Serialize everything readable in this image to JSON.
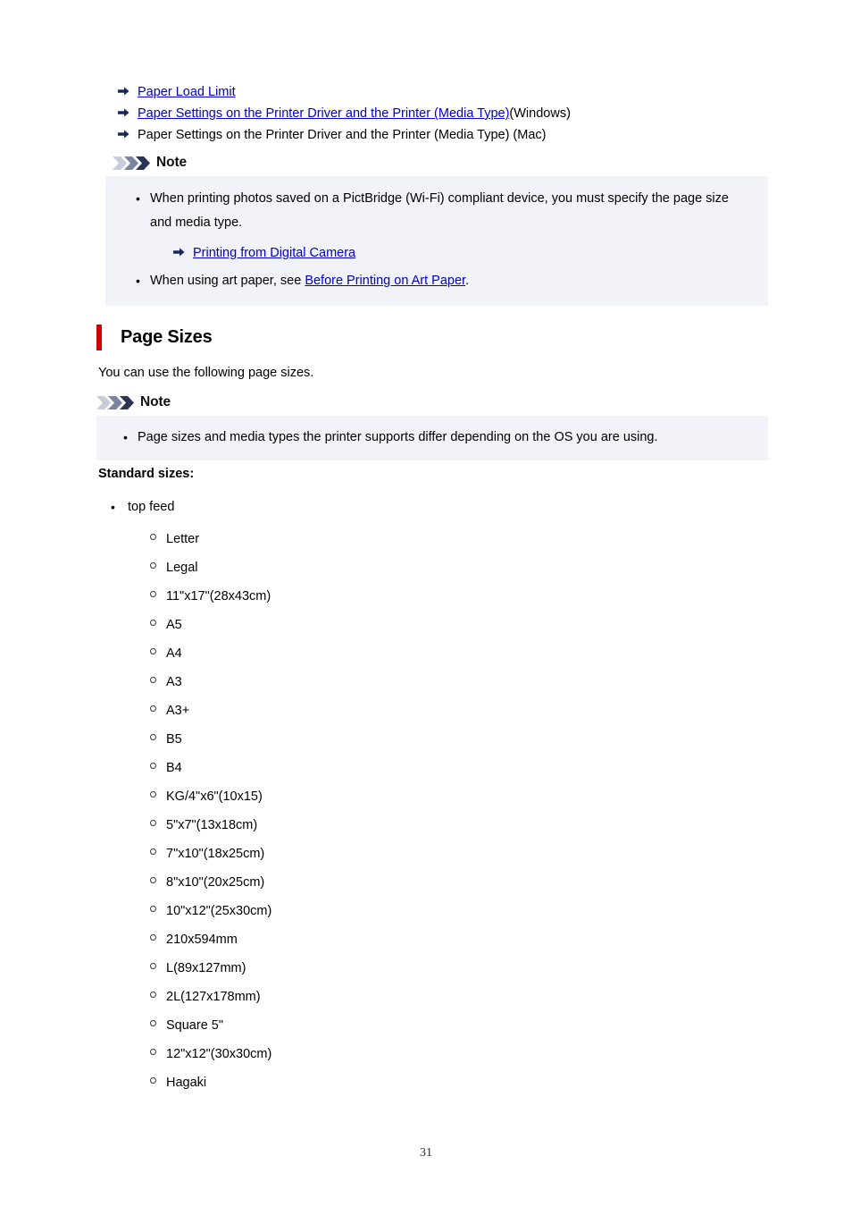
{
  "document": {
    "page_number": "31"
  },
  "top_links": [
    {
      "icon": "arrow-right-icon",
      "link_text": "Paper Load Limit",
      "is_link": true,
      "suffix": ""
    },
    {
      "icon": "arrow-right-icon",
      "link_text": "Paper Settings on the Printer Driver and the Printer (Media Type)",
      "is_link": true,
      "suffix": " (Windows)"
    },
    {
      "icon": "arrow-right-icon",
      "link_text": "Paper Settings on the Printer Driver and the Printer (Media Type) (Mac)",
      "is_link": false,
      "suffix": ""
    }
  ],
  "note_one": {
    "icon": "chevrons-icon",
    "title": "Note",
    "bullet_1": "When printing photos saved on a PictBridge (Wi-Fi) compliant device, you must specify the page size and media type.",
    "sublink": {
      "icon": "arrow-right-icon",
      "text": "Printing from Digital Camera"
    },
    "bullet_2_prefix": "When using art paper, see ",
    "bullet_2_link": "Before Printing on Art Paper",
    "bullet_2_suffix": "."
  },
  "section": {
    "title": "Page Sizes",
    "accent_color": "#d10000",
    "intro": "You can use the following page sizes."
  },
  "note_two": {
    "icon": "chevrons-icon",
    "title": "Note",
    "bullet_1": "Page sizes and media types the printer supports differ depending on the OS you are using."
  },
  "standard_sizes": {
    "label": "Standard sizes:",
    "feeds": [
      {
        "name": "top feed",
        "sizes": [
          "Letter",
          "Legal",
          "11\"x17\"(28x43cm)",
          "A5",
          "A4",
          "A3",
          "A3+",
          "B5",
          "B4",
          "KG/4\"x6\"(10x15)",
          "5\"x7\"(13x18cm)",
          "7\"x10\"(18x25cm)",
          "8\"x10\"(20x25cm)",
          "10\"x12\"(25x30cm)",
          "210x594mm",
          "L(89x127mm)",
          "2L(127x178mm)",
          "Square 5\"",
          "12\"x12\"(30x30cm)",
          "Hagaki"
        ]
      }
    ]
  }
}
